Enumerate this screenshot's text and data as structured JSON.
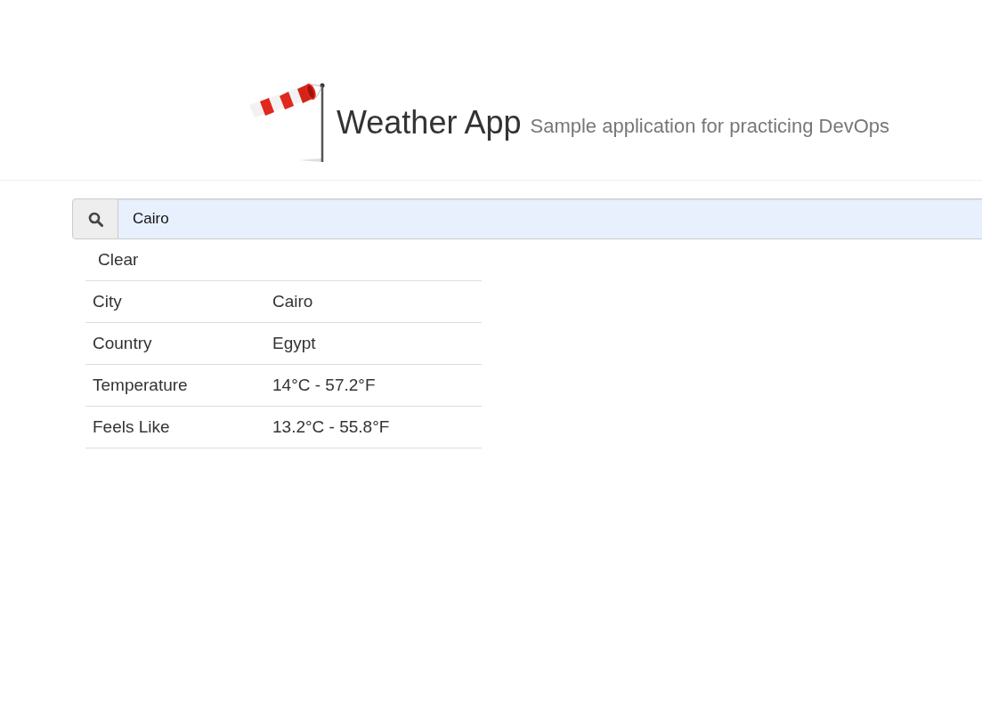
{
  "header": {
    "title": "Weather App",
    "subtitle": "Sample application for practicing DevOps"
  },
  "search": {
    "value": "Cairo"
  },
  "clear_button": {
    "label": "Clear"
  },
  "results": [
    {
      "label": "City",
      "value": "Cairo"
    },
    {
      "label": "Country",
      "value": "Egypt"
    },
    {
      "label": "Temperature",
      "value": "14°C - 57.2°F"
    },
    {
      "label": "Feels Like",
      "value": "13.2°C - 55.8°F"
    }
  ]
}
